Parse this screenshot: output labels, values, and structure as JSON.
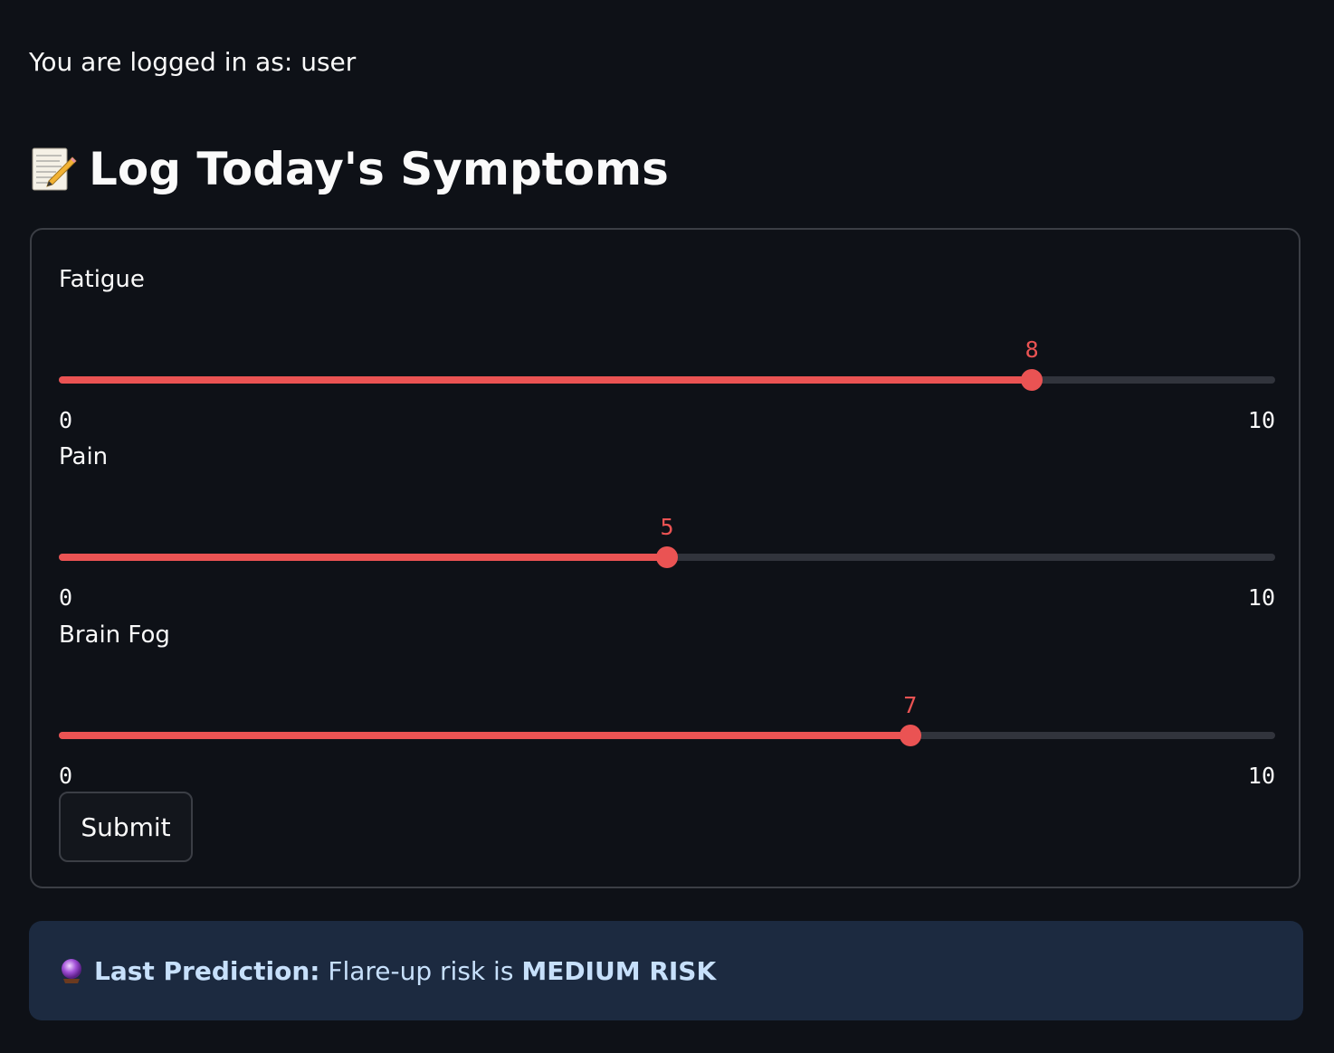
{
  "header": {
    "login_text": "You are logged in as: user"
  },
  "page": {
    "title": "Log Today's Symptoms",
    "title_icon": "memo-icon"
  },
  "form": {
    "sliders": [
      {
        "label": "Fatigue",
        "value": 8,
        "min": 0,
        "max": 10
      },
      {
        "label": "Pain",
        "value": 5,
        "min": 0,
        "max": 10
      },
      {
        "label": "Brain Fog",
        "value": 7,
        "min": 0,
        "max": 10
      }
    ],
    "submit_label": "Submit"
  },
  "prediction": {
    "icon": "crystal-ball-icon",
    "label": "Last Prediction:",
    "text": "Flare-up risk is",
    "risk": "MEDIUM RISK"
  },
  "colors": {
    "background": "#0e1117",
    "accent": "#ea5353",
    "track": "#31343c",
    "info_background": "#1c2a40",
    "info_text": "#c7e0fb"
  }
}
